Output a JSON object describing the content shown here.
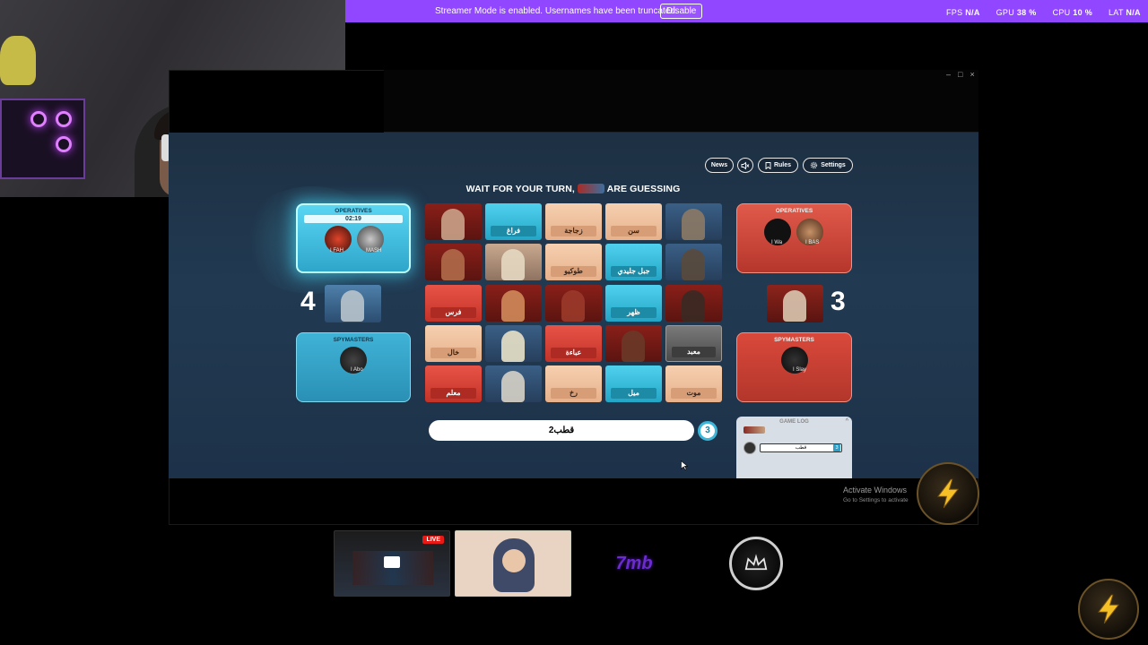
{
  "banner": {
    "message": "Streamer Mode is enabled. Usernames have been truncated.",
    "disable_label": "Disable",
    "fps_label": "FPS",
    "fps_value": "N/A",
    "gpu_label": "GPU",
    "gpu_value": "38 %",
    "cpu_label": "CPU",
    "cpu_value": "10 %",
    "lat_label": "LAT",
    "lat_value": "N/A"
  },
  "header": {
    "news": "News",
    "rules": "Rules",
    "settings": "Settings",
    "status_left": "WAIT FOR YOUR TURN,",
    "status_right": "ARE GUESSING"
  },
  "blue_team": {
    "operatives_title": "OPERATIVES",
    "timer": "02:19",
    "operative_1": "I FAH",
    "operative_2": "MASH",
    "score": "4",
    "spymasters_title": "SPYMASTERS",
    "spymaster_1": "I Abo"
  },
  "red_team": {
    "operatives_title": "OPERATIVES",
    "operative_1": "I Wa",
    "operative_2": "I BAS",
    "score": "3",
    "spymasters_title": "SPYMASTERS",
    "spymaster_1": "I Slay"
  },
  "board": {
    "row1": [
      "",
      "فراغ",
      "زجاجة",
      "سن",
      ""
    ],
    "row2": [
      "",
      "",
      "طوكيو",
      "جبل جليدي",
      ""
    ],
    "row3": [
      "فرس",
      "",
      "",
      "ظهر",
      ""
    ],
    "row4": [
      "خال",
      "",
      "عباءة",
      "",
      "معبد"
    ],
    "row5": [
      "معلم",
      "",
      "رخ",
      "ميل",
      "موت"
    ]
  },
  "clue": {
    "word": "قطب2",
    "count": "3"
  },
  "game_log": {
    "title": "GAME LOG",
    "entry_word": "قطب",
    "entry_count": "3"
  },
  "watermark": {
    "line1": "Activate Windows",
    "line2": "Go to Settings to activate"
  },
  "thumbs": {
    "live": "LIVE",
    "brand": "7mb"
  },
  "colors": {
    "accent": "#9146ff",
    "red": "#e04a3c",
    "blue": "#3ec3e3",
    "neutral": "#f2c4a0",
    "assassin": "#5c5c5c"
  }
}
